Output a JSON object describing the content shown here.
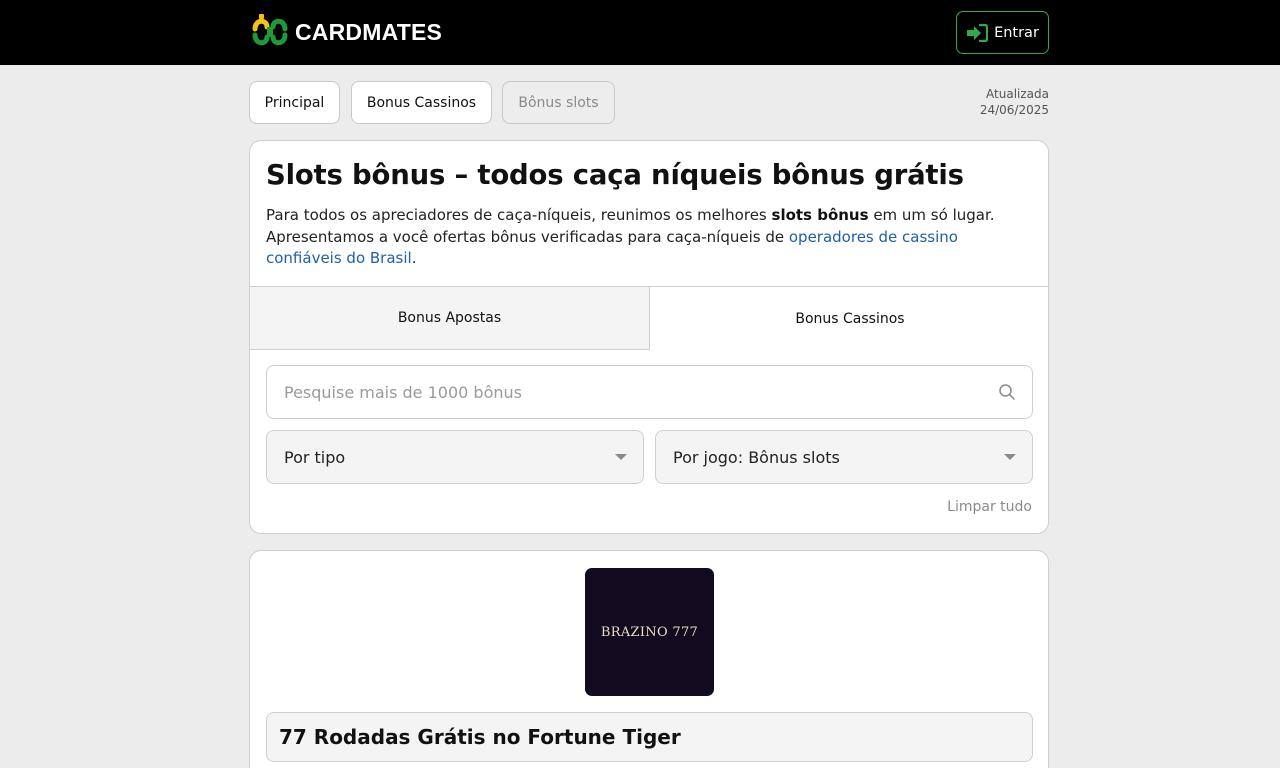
{
  "header": {
    "brand": "CARDMATES",
    "login_label": "Entrar",
    "colors": {
      "logo_green": "#1f9a3b",
      "logo_yellow": "#f2c318",
      "button_border": "#2fa84f"
    }
  },
  "breadcrumbs": [
    {
      "label": "Principal",
      "active": true
    },
    {
      "label": "Bonus Cassinos",
      "active": true
    },
    {
      "label": "Bônus slots",
      "active": false
    }
  ],
  "updated": {
    "label": "Atualizada",
    "date": "24/06/2025"
  },
  "main": {
    "title": "Slots bônus – todos caça níqueis bônus grátis",
    "intro": {
      "part1": "Para todos os apreciadores de caça-níqueis, reunimos os melhores ",
      "bold": "slots bônus",
      "part2": " em um só lugar. Apresentamos a você ofertas bônus verificadas para caça-níqueis de ",
      "link": "operadores de cassino confiáveis do Brasil",
      "part3": "."
    },
    "tabs": [
      {
        "label": "Bonus Apostas",
        "selected": false
      },
      {
        "label": "Bonus Cassinos",
        "selected": true
      }
    ],
    "search": {
      "placeholder": "Pesquise mais de 1000 bônus",
      "value": ""
    },
    "filters": [
      {
        "value": "Por tipo"
      },
      {
        "value": "Por jogo: Bônus slots"
      }
    ],
    "clear_label": "Limpar tudo"
  },
  "offer_card": {
    "casino_logo_text": "BRAZINO 777",
    "title": "77 Rodadas Grátis no Fortune Tiger"
  }
}
